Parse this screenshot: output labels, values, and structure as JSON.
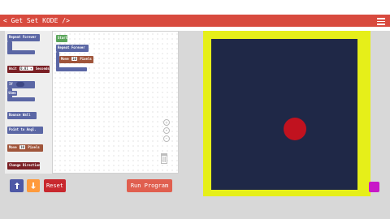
{
  "app": {
    "title": "< Get Set KODE />"
  },
  "toolbox": {
    "blocks": [
      {
        "label": "Repeat Forever"
      },
      {
        "label": "Wait",
        "value": "0.01 ▾",
        "suffix": "Seconds"
      },
      {
        "label": "If",
        "sub": "then"
      },
      {
        "label": "Bounce Wall"
      },
      {
        "label": "Point to Angl."
      },
      {
        "label": "Move",
        "value": "10",
        "suffix": "Pixels"
      },
      {
        "label": "Change Direction"
      }
    ]
  },
  "workspace": {
    "start_label": "Start",
    "repeat_label": "Repeat Forever",
    "move_label": "Move",
    "move_value": "10",
    "move_suffix": "Pixels"
  },
  "controls": {
    "reset_label": "Reset",
    "run_label": "Run Program"
  },
  "colors": {
    "header": "#d84a3e",
    "stage_border": "#e6ef19",
    "stage_bg": "#1f2847",
    "ball": "#c1121f"
  }
}
